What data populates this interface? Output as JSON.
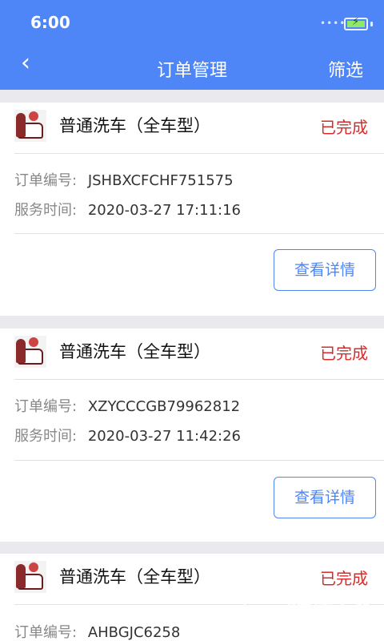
{
  "status_bar": {
    "time": "6:00"
  },
  "nav": {
    "back_icon": "chevron-left-icon",
    "title": "订单管理",
    "filter_label": "筛选"
  },
  "orders": [
    {
      "service": "普通洗车（全车型）",
      "status": "已完成",
      "order_label": "订单编号:",
      "order_no": "JSHBXCFCHF751575",
      "time_label": "服务时间:",
      "time": "2020-03-27 17:11:16",
      "button": "查看详情"
    },
    {
      "service": "普通洗车（全车型）",
      "status": "已完成",
      "order_label": "订单编号:",
      "order_no": "XZYCCCGB79962812",
      "time_label": "服务时间:",
      "time": "2020-03-27 11:42:26",
      "button": "查看详情"
    },
    {
      "service": "普通洗车（全车型）",
      "status": "已完成",
      "order_label": "订单编号:",
      "order_no": "AHBGJC6258"
    }
  ],
  "watermark": {
    "text": "硬件之家",
    "sub": "YING JIAN ZHI JIA.COM"
  },
  "colors": {
    "header": "#4f86f7",
    "status": "#d42b2b",
    "accent": "#4f86f7"
  }
}
